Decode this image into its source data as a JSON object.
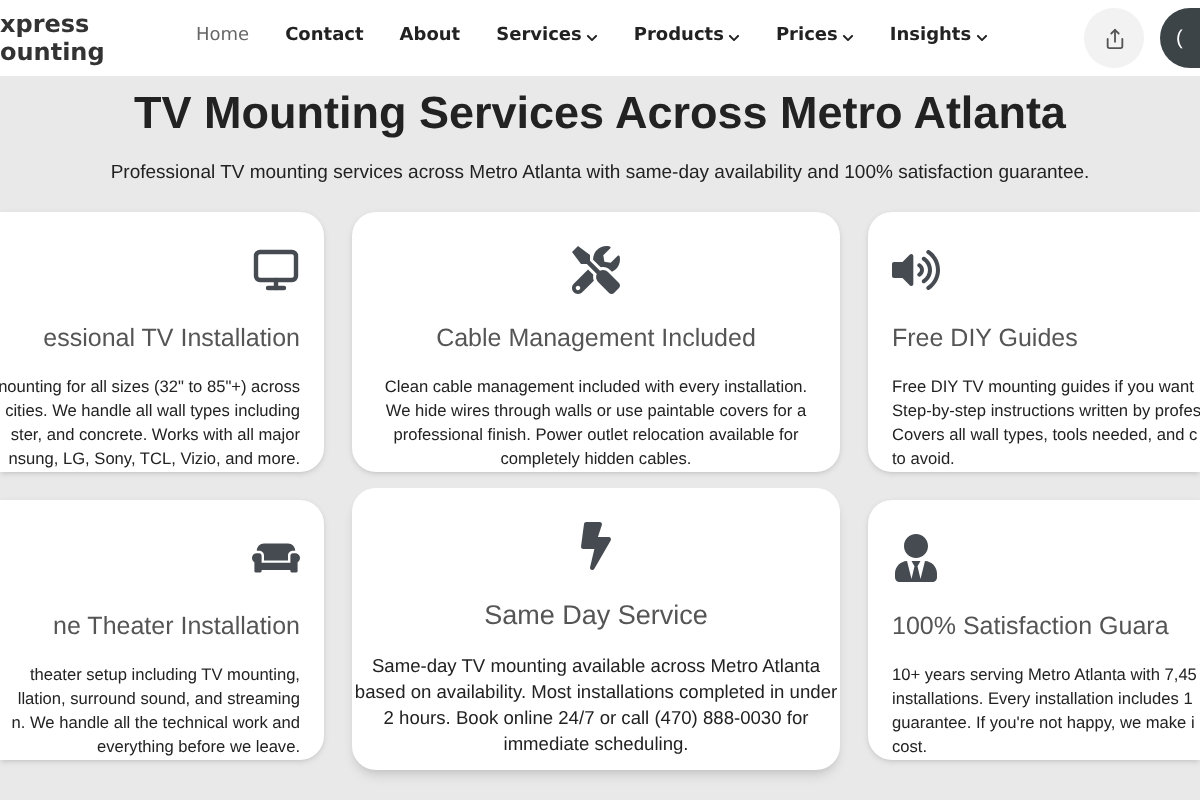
{
  "header": {
    "logo_lines": [
      "xpress",
      "ounting"
    ],
    "nav": [
      {
        "label": "Home",
        "selected": true,
        "dropdown": false
      },
      {
        "label": "Contact",
        "selected": false,
        "dropdown": false
      },
      {
        "label": "About",
        "selected": false,
        "dropdown": false
      },
      {
        "label": "Services",
        "selected": false,
        "dropdown": true
      },
      {
        "label": "Products",
        "selected": false,
        "dropdown": true
      },
      {
        "label": "Prices",
        "selected": false,
        "dropdown": true
      },
      {
        "label": "Insights",
        "selected": false,
        "dropdown": true
      }
    ],
    "call_button": "("
  },
  "title": "TV Mounting Services Across Metro Atlanta",
  "subtitle": "Professional TV mounting services across Metro Atlanta with same-day availability and 100% satisfaction guarantee.",
  "rows": [
    [
      {
        "kind": "tv",
        "title": "essional TV Installation",
        "lines": [
          "nounting for all sizes (32\" to 85\"+) across",
          "cities. We handle all wall types including",
          "ster, and concrete. Works with all major",
          "nsung, LG, Sony, TCL, Vizio, and more."
        ],
        "raised": false
      },
      {
        "kind": "tools",
        "title": "Cable Management Included",
        "lines": [
          "Clean cable management included with every installation.",
          "We hide wires through walls or use paintable covers for a",
          "professional finish. Power outlet relocation available for",
          "completely hidden cables."
        ],
        "raised": false
      },
      {
        "kind": "speaker",
        "title": "Free DIY Guides",
        "lines": [
          "Free DIY TV mounting guides if you want",
          "Step-by-step instructions written by profes",
          "Covers all wall types, tools needed, and c",
          "to avoid."
        ],
        "raised": false
      }
    ],
    [
      {
        "kind": "couch",
        "title": "ne Theater Installation",
        "lines": [
          "theater setup including TV mounting,",
          "llation, surround sound, and streaming",
          "n. We handle all the technical work and",
          "everything before we leave."
        ],
        "raised": false
      },
      {
        "kind": "bolt",
        "title": "Same Day Service",
        "lines": [
          "Same-day TV mounting available across Metro Atlanta",
          "based on availability. Most installations completed in under",
          "2 hours. Book online 24/7 or call (470) 888-0030 for",
          "immediate scheduling."
        ],
        "raised": true
      },
      {
        "kind": "person",
        "title": "100% Satisfaction Guara",
        "lines": [
          "10+ years serving Metro Atlanta with 7,45",
          "installations. Every installation includes 1",
          "guarantee. If you're not happy, we make i",
          "cost."
        ],
        "raised": false
      }
    ]
  ]
}
